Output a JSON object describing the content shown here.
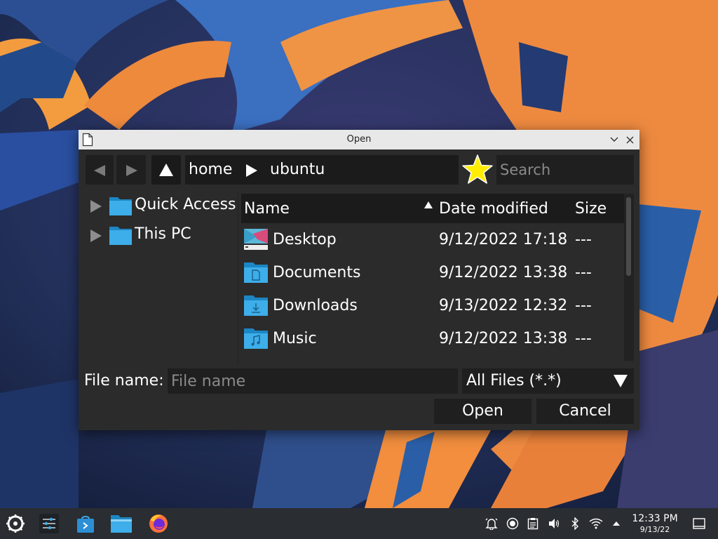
{
  "window": {
    "title": "Open"
  },
  "breadcrumb": {
    "segments": [
      "home",
      "ubuntu"
    ]
  },
  "search": {
    "placeholder": "Search",
    "value": ""
  },
  "sidebar": {
    "items": [
      {
        "label": "Quick Access",
        "icon": "folder-icon",
        "expanded": false
      },
      {
        "label": "This PC",
        "icon": "folder-icon",
        "expanded": false
      }
    ]
  },
  "file_list": {
    "columns": {
      "name": "Name",
      "date": "Date modified",
      "size": "Size"
    },
    "sort": {
      "column": "Name",
      "direction": "ascending"
    },
    "rows": [
      {
        "name": "Desktop",
        "date": "9/12/2022 17:18",
        "size": "---",
        "icon": "desktop-folder-icon"
      },
      {
        "name": "Documents",
        "date": "9/12/2022 13:38",
        "size": "---",
        "icon": "documents-folder-icon"
      },
      {
        "name": "Downloads",
        "date": "9/13/2022 12:32",
        "size": "---",
        "icon": "downloads-folder-icon"
      },
      {
        "name": "Music",
        "date": "9/12/2022 13:38",
        "size": "---",
        "icon": "music-folder-icon"
      }
    ]
  },
  "filename": {
    "label": "File name:",
    "placeholder": "File name",
    "value": ""
  },
  "filter": {
    "selected": "All Files (*.*)"
  },
  "buttons": {
    "open": "Open",
    "cancel": "Cancel"
  },
  "taskbar": {
    "apps": [
      "application-launcher-icon",
      "system-settings-icon",
      "discover-store-icon",
      "dolphin-file-manager-icon",
      "firefox-icon"
    ],
    "tray": [
      "notifications-icon",
      "update-icon",
      "clipboard-icon",
      "volume-icon",
      "bluetooth-icon",
      "wifi-icon",
      "expand-tray-icon"
    ],
    "clock": {
      "time": "12:33 PM",
      "date": "9/13/22"
    }
  },
  "colors": {
    "dialog_bg": "#2b2b2b",
    "titlebar_bg": "#e8e8e8",
    "field_bg": "#1f1f1f",
    "folder_blue": "#3daee9",
    "star_yellow": "#ffee00",
    "taskbar_bg": "#2a2d31"
  }
}
